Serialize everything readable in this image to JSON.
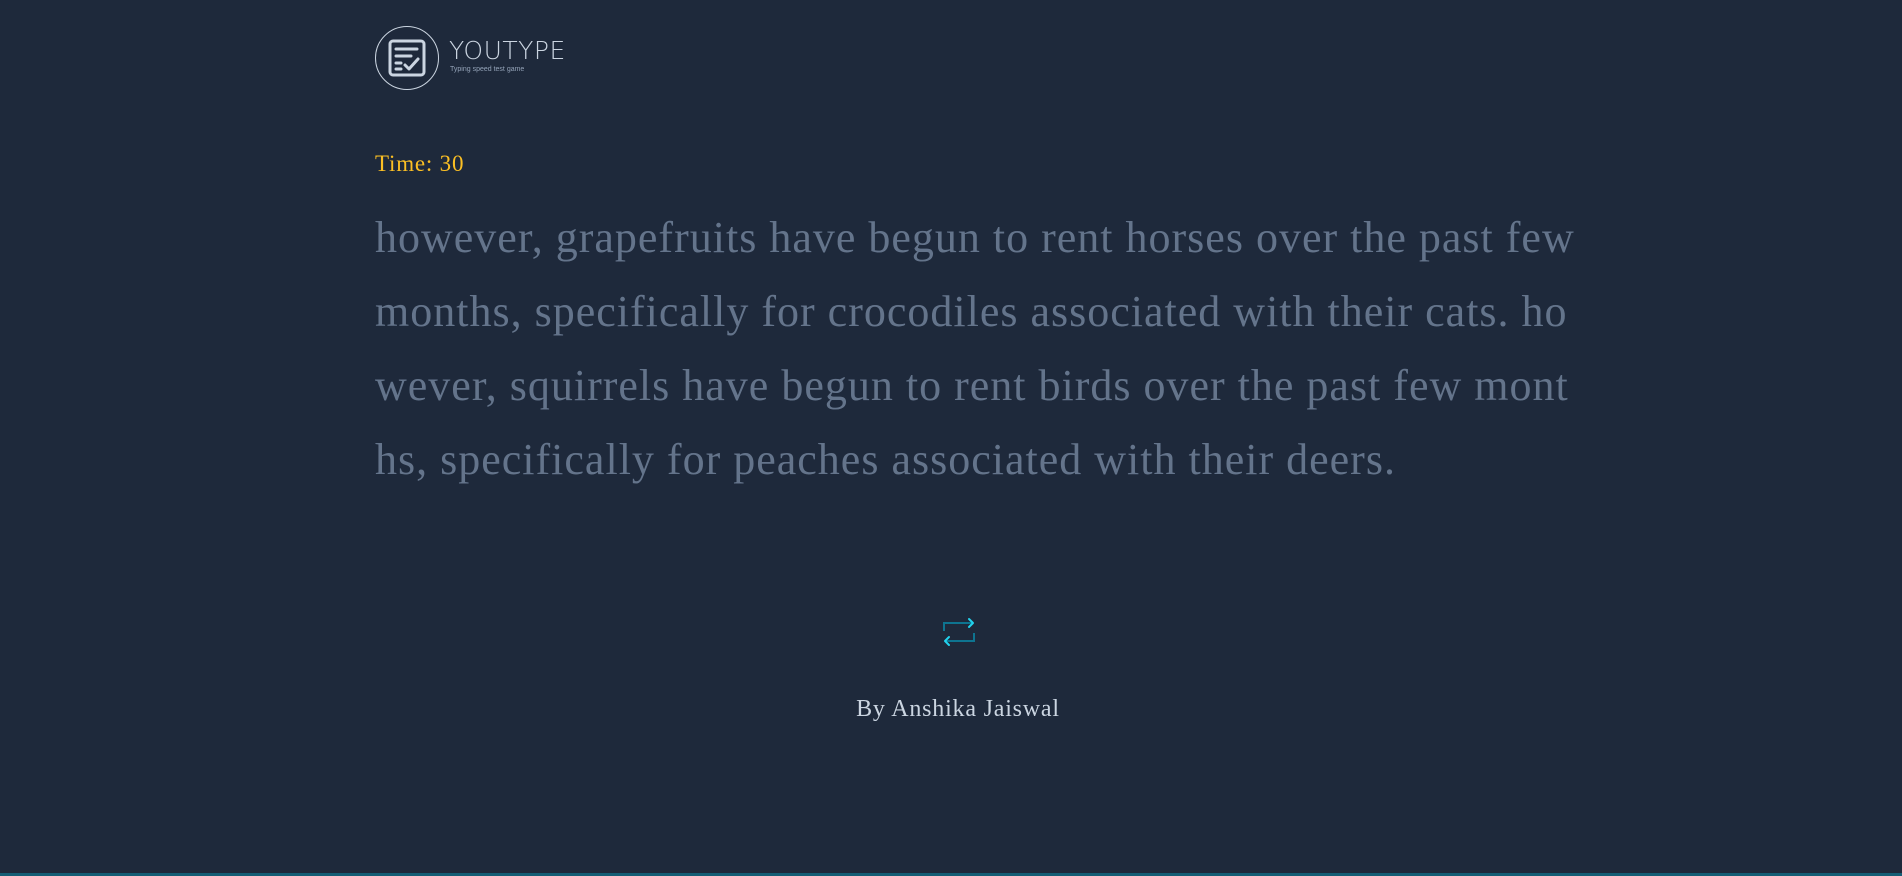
{
  "app": {
    "brand_name": "YOUTYPE",
    "tagline": "Typing speed test game",
    "logo_icon": "checklist-icon"
  },
  "timer": {
    "text": "Time: 30"
  },
  "passage": {
    "text": "however, grapefruits have begun to rent horses over the past few months, specifically for crocodiles associated with their cats. however, squirrels have begun to rent birds over the past few months, specifically for peaches associated with their deers."
  },
  "controls": {
    "restart_icon": "restart-arrows-icon"
  },
  "footer": {
    "credit": "By Anshika Jaiswal"
  },
  "colors": {
    "background": "#1e293b",
    "timer": "#fbbf24",
    "passage": "#64748b",
    "accent": "#22d3ee",
    "text_light": "#cbd5e1"
  }
}
